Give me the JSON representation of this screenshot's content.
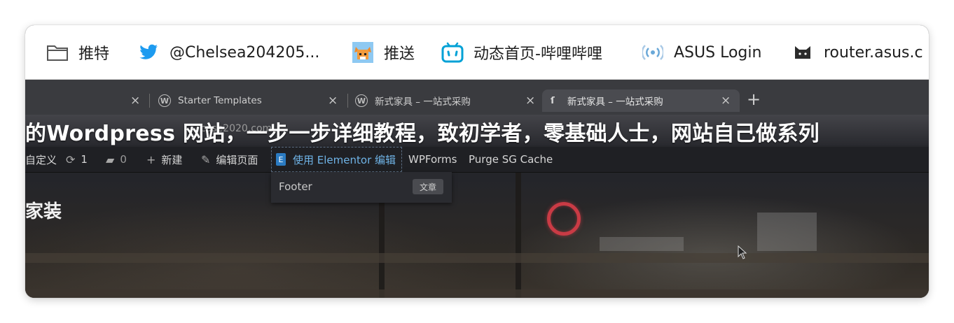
{
  "bookmarks": [
    {
      "icon": "folder-icon",
      "label": "推特"
    },
    {
      "icon": "twitter-bird-icon",
      "label": "@Chelsea204205..."
    },
    {
      "icon": "fox-avatar-icon",
      "label": "推送"
    },
    {
      "icon": "bilibili-tv-icon",
      "label": "动态首页-哔哩哔哩"
    },
    {
      "icon": "wifi-signal-icon",
      "label": "ASUS Login"
    },
    {
      "icon": "cat-icon",
      "label": "router.asus.c"
    }
  ],
  "video": {
    "tabs": [
      {
        "label": "Starter Templates"
      },
      {
        "label": "新式家具 – 一站式采购"
      },
      {
        "label": "新式家具 – 一站式采购"
      }
    ],
    "caption_under": "case2020.com",
    "caption": "的Wordpress 网站，一步一步详细教程，致初学者，零基础人士，网站自己做系列",
    "adminbar": {
      "customize": "自定义",
      "updates_count": "1",
      "comments_count": "0",
      "new": "新建",
      "edit_page": "编辑页面",
      "elementor": "使用 Elementor 编辑",
      "wpforms": "WPForms",
      "purge": "Purge SG Cache"
    },
    "dropdown": {
      "label": "Footer",
      "badge": "文章"
    },
    "heading": "家装"
  }
}
